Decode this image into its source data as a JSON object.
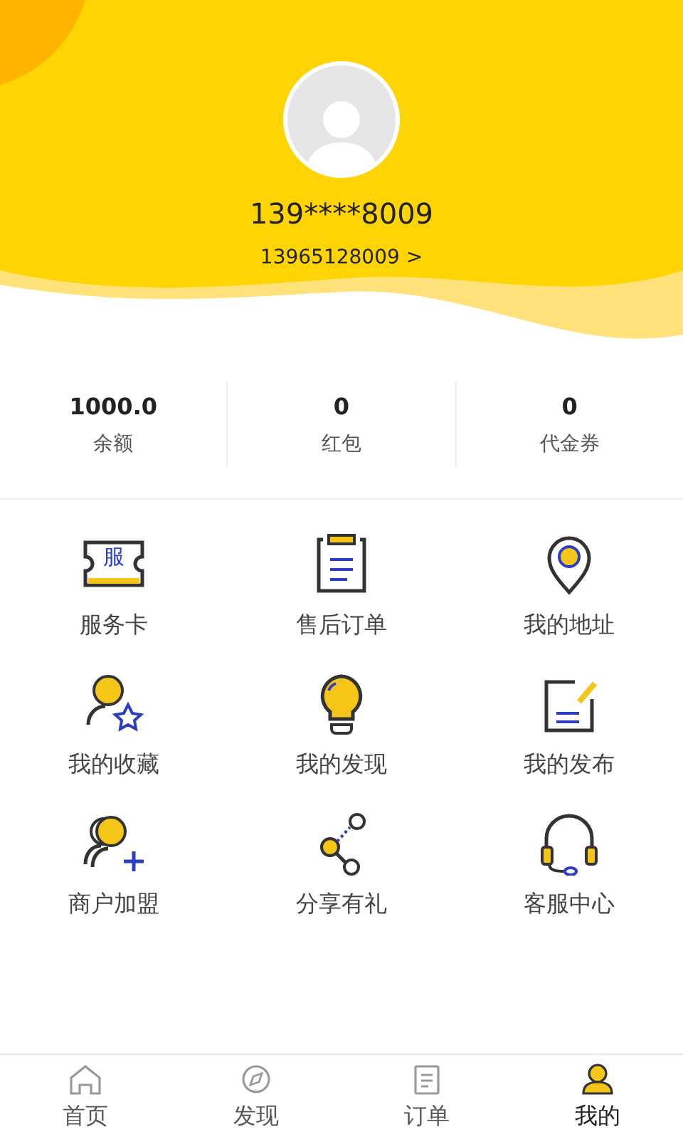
{
  "profile": {
    "phone": "139****8009",
    "account_link": "13965128009 >"
  },
  "stats": [
    {
      "value": "1000.0",
      "label": "余额"
    },
    {
      "value": "0",
      "label": "红包"
    },
    {
      "value": "0",
      "label": "代金券"
    }
  ],
  "menu": [
    {
      "label": "服务卡",
      "badge": "服"
    },
    {
      "label": "售后订单"
    },
    {
      "label": "我的地址"
    },
    {
      "label": "我的收藏"
    },
    {
      "label": "我的发现"
    },
    {
      "label": "我的发布"
    },
    {
      "label": "商户加盟"
    },
    {
      "label": "分享有礼"
    },
    {
      "label": "客服中心"
    }
  ],
  "tab_bar": [
    {
      "label": "首页",
      "selected": false
    },
    {
      "label": "发现",
      "selected": false
    },
    {
      "label": "订单",
      "selected": false
    },
    {
      "label": "我的",
      "selected": true
    }
  ]
}
